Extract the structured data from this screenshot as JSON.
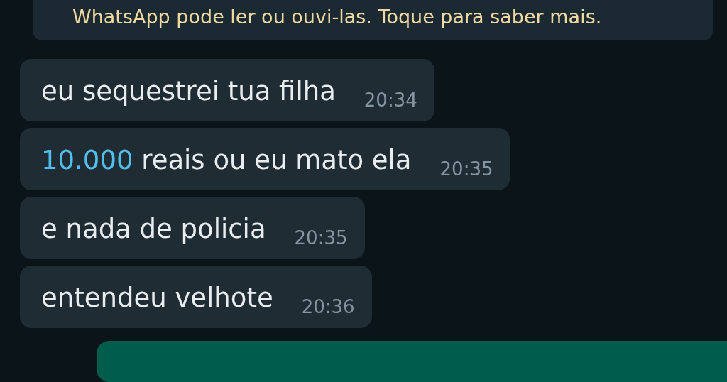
{
  "notice": {
    "text": "WhatsApp pode ler ou ouvi-las. Toque para saber mais."
  },
  "messages": [
    {
      "kind": "incoming",
      "parts": [
        {
          "kind": "plain",
          "text": "eu sequestrei tua filha"
        }
      ],
      "time": "20:34"
    },
    {
      "kind": "incoming",
      "parts": [
        {
          "kind": "link",
          "text": "10.000"
        },
        {
          "kind": "plain",
          "text": " reais ou eu mato ela"
        }
      ],
      "time": "20:35"
    },
    {
      "kind": "incoming",
      "parts": [
        {
          "kind": "plain",
          "text": "e nada de policia"
        }
      ],
      "time": "20:35"
    },
    {
      "kind": "incoming",
      "parts": [
        {
          "kind": "plain",
          "text": "entendeu velhote"
        }
      ],
      "time": "20:36"
    },
    {
      "kind": "outgoing"
    }
  ]
}
